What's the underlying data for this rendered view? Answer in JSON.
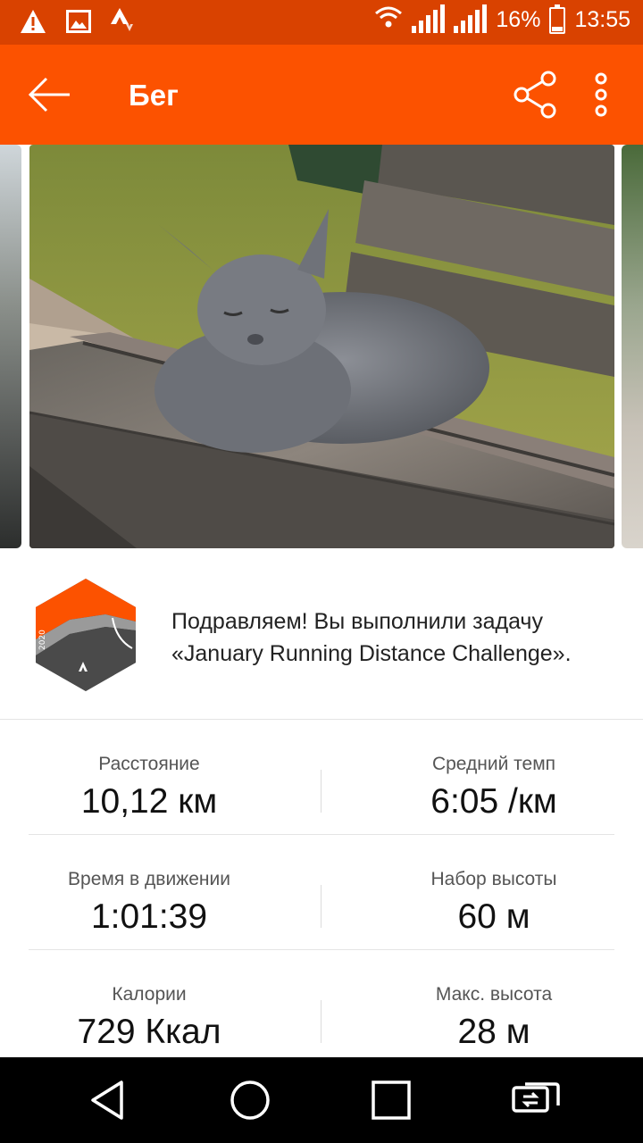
{
  "status_bar": {
    "battery_percent": "16%",
    "time": "13:55",
    "icons": [
      "warning-icon",
      "gallery-icon",
      "strava-icon",
      "wifi-icon",
      "signal-sim1-icon",
      "signal-sim2-icon",
      "battery-icon"
    ]
  },
  "app_bar": {
    "title": "Бег",
    "back_icon": "arrow-left-icon",
    "share_icon": "share-icon",
    "more_icon": "more-vertical-icon",
    "color": "#fc5200"
  },
  "photo": {
    "subject": "grey cat on wooden bench"
  },
  "challenge": {
    "badge_year": "2020",
    "message": "Подравляем! Вы выполнили задачу «January Running Distance Challenge»."
  },
  "stats": [
    {
      "left": {
        "label": "Расстояние",
        "value": "10,12 км"
      },
      "right": {
        "label": "Средний темп",
        "value": "6:05 /км"
      }
    },
    {
      "left": {
        "label": "Время в движении",
        "value": "1:01:39"
      },
      "right": {
        "label": "Набор высоты",
        "value": "60 м"
      }
    },
    {
      "left": {
        "label": "Калории",
        "value": "729 Ккал"
      },
      "right": {
        "label": "Макс. высота",
        "value": "28 м"
      }
    }
  ],
  "nav_bar": {
    "icons": [
      "back-triangle-icon",
      "home-circle-icon",
      "recents-square-icon",
      "screen-cast-icon"
    ]
  }
}
